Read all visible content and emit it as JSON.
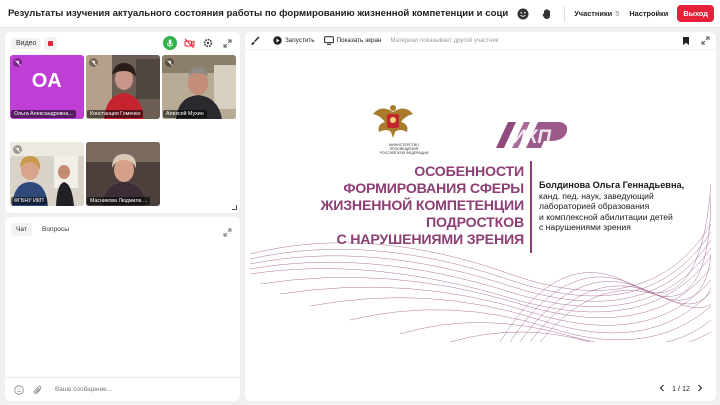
{
  "header": {
    "title": "Результаты изучения актуального состояния работы по формированию жизненной компетенции и социализации подростк...",
    "participants_label": "Участники",
    "participants_count": "5",
    "settings_label": "Настройки",
    "exit_label": "Выход",
    "exit_color": "#e8213a"
  },
  "video_panel": {
    "label": "Видео",
    "tiles": [
      {
        "name": "Ольга Александровна...",
        "initials": "ОА",
        "avatar_color": "#bf3fd6"
      },
      {
        "name": "Констанция Гоменко"
      },
      {
        "name": "Алексей Мухин"
      },
      {
        "name": "ФГБНУ ИКП"
      },
      {
        "name": "Масникова Людмила ..."
      }
    ]
  },
  "chat": {
    "tabs": [
      "Чат",
      "Вопросы"
    ],
    "input_placeholder": "Ваше сообщение..."
  },
  "slide_toolbar": {
    "start_label": "Запустить",
    "share_label": "Показать экран",
    "note": "Материал показывает другой участник"
  },
  "slide": {
    "crest_caption": "Министерство просвещения Российской Федерации",
    "logo_text": "ИКП",
    "heading_lines": [
      "Особенности",
      "формирования сферы",
      "жизненной компетенции",
      "подростков",
      "с нарушениями зрения"
    ],
    "author_name": "Болдинова Ольга Геннадьевна,",
    "author_lines": [
      "канд. пед. наук, заведующий",
      "лабораторией  образования",
      "и комплексной  абилитации детей",
      "с нарушениями зрения"
    ],
    "accent_color": "#8c3e75"
  },
  "pager": {
    "current": "1",
    "separator": "/",
    "total": "12"
  }
}
